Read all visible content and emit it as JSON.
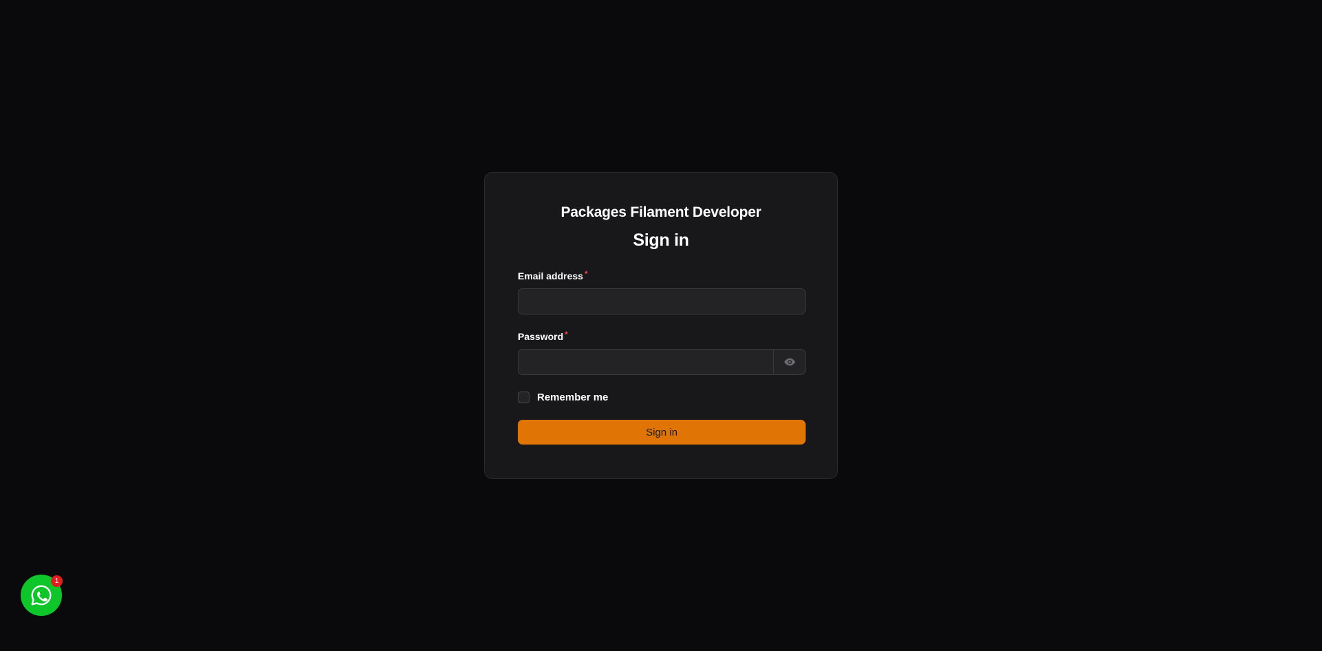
{
  "card": {
    "brand": "Packages Filament Developer",
    "heading": "Sign in"
  },
  "form": {
    "email": {
      "label": "Email address",
      "required_mark": "*",
      "value": ""
    },
    "password": {
      "label": "Password",
      "required_mark": "*",
      "value": "",
      "reveal_icon": "eye-icon"
    },
    "remember": {
      "label": "Remember me",
      "checked": false
    },
    "submit_label": "Sign in"
  },
  "chat_widget": {
    "icon": "whatsapp-icon",
    "badge_count": "1"
  },
  "colors": {
    "background": "#0a0a0c",
    "card": "#18181b",
    "accent": "#e07506",
    "required": "#ef4444",
    "whatsapp": "#0ec62a",
    "badge": "#e11d1d"
  }
}
